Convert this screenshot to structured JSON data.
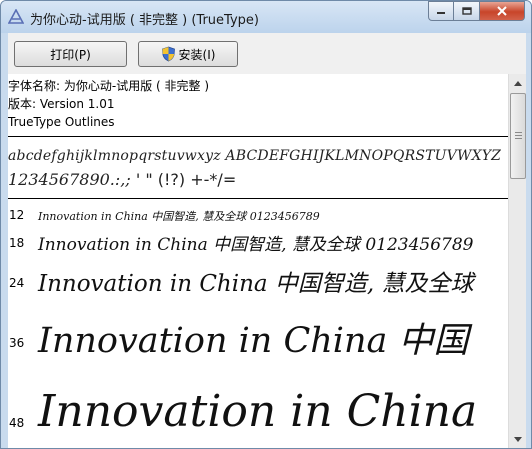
{
  "window": {
    "title": "为你心动-试用版 ( 非完整 ) (TrueType)"
  },
  "toolbar": {
    "print_label": "打印(P)",
    "install_label": "安装(I)"
  },
  "info": {
    "font_name": "字体名称: 为你心动-试用版 ( 非完整 )",
    "version": "版本: Version 1.01",
    "outline_type": "TrueType Outlines"
  },
  "charset": {
    "line1": "abcdefghijklmnopqrstuvwxyz ABCDEFGHIJKLMNOPQRSTUVWXYZ",
    "line2_digits": "1234567890.:,;",
    "line2_symbols": "' \" (!?) +-*/="
  },
  "samples": [
    {
      "size": "12",
      "text": "Innovation in China 中国智造, 慧及全球 0123456789"
    },
    {
      "size": "18",
      "text": "Innovation in China 中国智造, 慧及全球 0123456789"
    },
    {
      "size": "24",
      "text": "Innovation in China 中国智造, 慧及全球"
    },
    {
      "size": "36",
      "text": "Innovation in China 中国"
    },
    {
      "size": "48",
      "text": "Innovation in China"
    }
  ]
}
